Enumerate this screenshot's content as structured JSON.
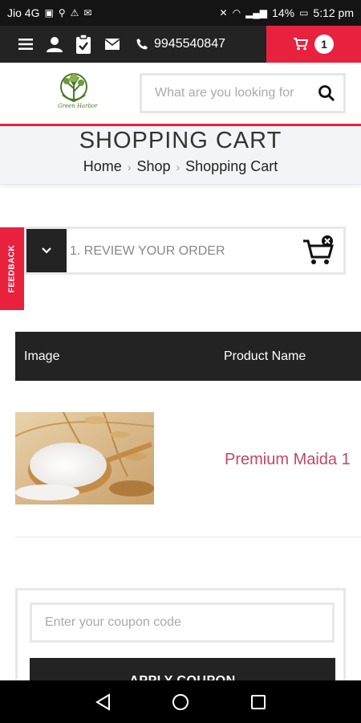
{
  "status_bar": {
    "carrier": "Jio 4G",
    "battery": "14%",
    "time": "5:12 pm"
  },
  "top_bar": {
    "phone": "9945540847",
    "cart_count": "1"
  },
  "header": {
    "logo_text": "Green Harbor",
    "search_placeholder": "What are you looking for"
  },
  "page": {
    "title": "SHOPPING CART",
    "breadcrumb": [
      "Home",
      "Shop",
      "Shopping Cart"
    ]
  },
  "feedback_label": "FEEDBACK",
  "review": {
    "label": "1. REVIEW YOUR ORDER"
  },
  "table": {
    "headers": [
      "Image",
      "Product Name"
    ],
    "rows": [
      {
        "product_name": "Premium Maida 1"
      }
    ]
  },
  "coupon": {
    "placeholder": "Enter your coupon code",
    "button_label": "APPLY COUPON"
  },
  "colors": {
    "accent": "#e8213f",
    "dark": "#232323",
    "product_name": "#c2466a"
  }
}
